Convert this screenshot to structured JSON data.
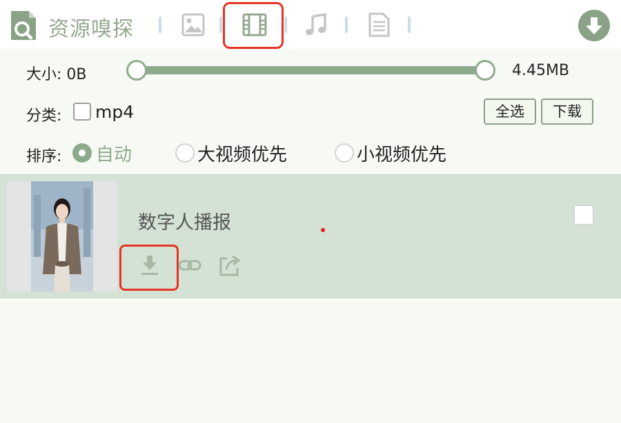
{
  "header": {
    "app_title": "资源嗅探",
    "tabs": [
      {
        "name": "image",
        "icon": "image-icon",
        "active": false
      },
      {
        "name": "video",
        "icon": "film-icon",
        "active": true
      },
      {
        "name": "audio",
        "icon": "music-note-icon",
        "active": false
      },
      {
        "name": "document",
        "icon": "document-icon",
        "active": false
      }
    ],
    "download_all_icon": "download-circle-icon"
  },
  "filters": {
    "size_label": "大小: 0B",
    "size_max": "4.45MB",
    "size_range_fraction": [
      0.0,
      1.0
    ],
    "category_label": "分类:",
    "category_options": [
      {
        "label": "mp4",
        "checked": false
      }
    ],
    "select_all_label": "全选",
    "download_label": "下载",
    "sort_label": "排序:",
    "sort_options": [
      {
        "label": "自动",
        "checked": true
      },
      {
        "label": "大视频优先",
        "checked": false
      },
      {
        "label": "小视频优先",
        "checked": false
      }
    ]
  },
  "resources": [
    {
      "title": "数字人播报",
      "checked": false,
      "actions": [
        "download-icon",
        "link-icon",
        "share-icon"
      ]
    }
  ],
  "colors": {
    "accent": "#8eaa8c",
    "highlight": "#e63323",
    "list_item_bg": "#d3e2d4",
    "page_bg": "#f7faf4"
  }
}
